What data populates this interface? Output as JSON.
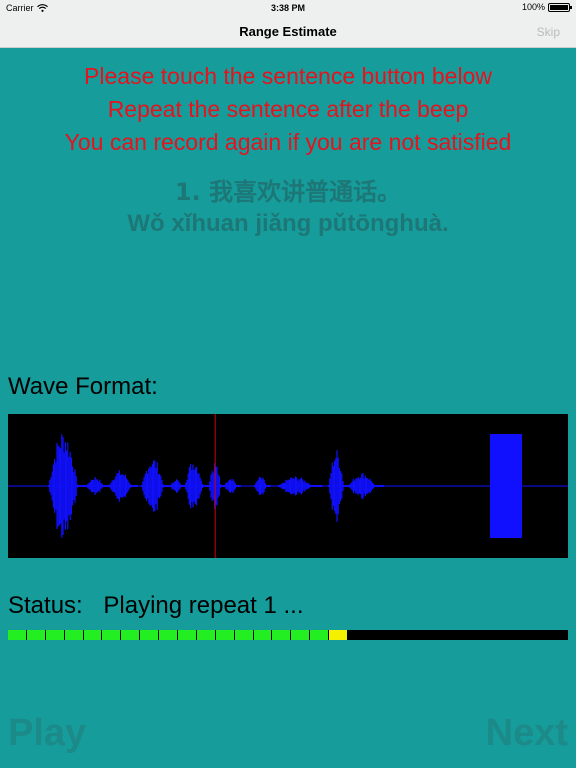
{
  "status_bar": {
    "carrier": "Carrier",
    "time": "3:38 PM",
    "battery_percent": "100%",
    "battery_level": 1.0,
    "wifi_icon": "wifi-icon",
    "battery_icon": "battery-icon"
  },
  "nav": {
    "title": "Range Estimate",
    "skip_label": "Skip"
  },
  "instructions": {
    "line1": "Please touch the sentence button below",
    "line2": "Repeat the sentence after the beep",
    "line3": "You can record again if you are not satisfied"
  },
  "sentence": {
    "hanzi": "1. 我喜欢讲普通话。",
    "pinyin": "Wǒ xǐhuan jiǎng pǔtōnghuà."
  },
  "wave": {
    "label": "Wave Format:",
    "playhead_fraction": 0.37
  },
  "status": {
    "label": "Status:",
    "value": "Playing repeat 1 ...",
    "progress_filled_segments": 18,
    "progress_total_segments": 30
  },
  "buttons": {
    "play_label": "Play",
    "next_label": "Next"
  },
  "colors": {
    "background": "#169c9b",
    "instruction_text": "#e4141e",
    "disabled_text": "#1e7777",
    "waveform": "#1010ff",
    "playhead": "#cc0000",
    "progress_done": "#22ee22",
    "progress_current": "#f4f000"
  }
}
